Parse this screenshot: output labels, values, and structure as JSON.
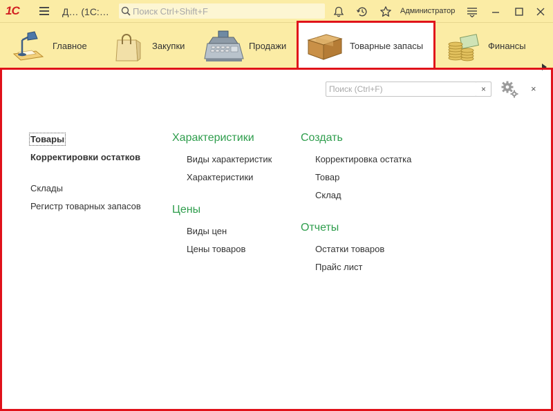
{
  "window": {
    "logo": "1С",
    "title": "Д…  (1С:…",
    "search_placeholder": "Поиск Ctrl+Shift+F",
    "user": "Администратор"
  },
  "sections": [
    {
      "label": "Главное",
      "icon": "desk-lamp-icon"
    },
    {
      "label": "Закупки",
      "icon": "shopping-bag-icon"
    },
    {
      "label": "Продажи",
      "icon": "cash-register-icon"
    },
    {
      "label": "Товарные запасы",
      "icon": "cardboard-box-icon",
      "active": true
    },
    {
      "label": "Финансы",
      "icon": "coins-icon"
    }
  ],
  "content": {
    "search_placeholder": "Поиск (Ctrl+F)",
    "clear_label": "×",
    "close_label": "×",
    "nav_links": [
      {
        "label": "Товары",
        "bold": true
      },
      {
        "label": "Корректировки остатков",
        "bold": true
      },
      {
        "label": "Склады",
        "bold": false
      },
      {
        "label": "Регистр товарных запасов",
        "bold": false
      }
    ],
    "groups": [
      {
        "title": "Характеристики",
        "items": [
          "Виды характеристик",
          "Характеристики"
        ]
      },
      {
        "title": "Цены",
        "items": [
          "Виды цен",
          "Цены товаров"
        ]
      },
      {
        "title": "Создать",
        "items": [
          "Корректировка остатка",
          "Товар",
          "Склад"
        ]
      },
      {
        "title": "Отчеты",
        "items": [
          "Остатки товаров",
          "Прайс лист"
        ]
      }
    ]
  },
  "colors": {
    "panel": "#fbeca5",
    "highlight_frame": "#e0121a",
    "group_title": "#2e9d4c"
  }
}
